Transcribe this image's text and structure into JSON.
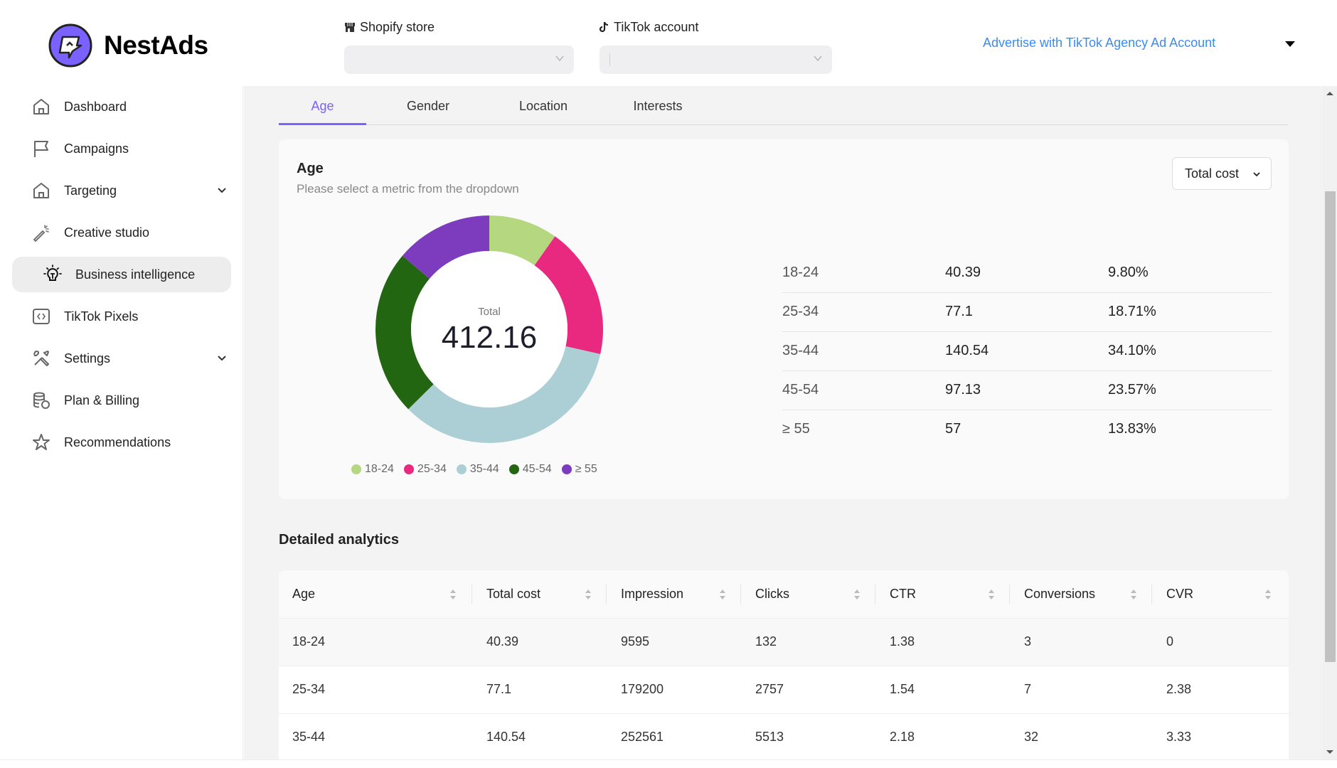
{
  "app": {
    "name": "NestAds",
    "brand_color": "#7b61ff"
  },
  "header": {
    "shopify_label": "Shopify store",
    "shopify_value": "",
    "tiktok_label": "TikTok account",
    "tiktok_value": "",
    "agency_link": "Advertise with TikTok Agency Ad Account"
  },
  "sidebar": {
    "items": [
      {
        "label": "Dashboard",
        "icon": "home-icon"
      },
      {
        "label": "Campaigns",
        "icon": "flag-icon"
      },
      {
        "label": "Targeting",
        "icon": "home-icon",
        "expandable": true
      },
      {
        "label": "Creative studio",
        "icon": "magic-wand-icon"
      },
      {
        "label": "Business intelligence",
        "icon": "lightbulb-icon",
        "active": true
      },
      {
        "label": "TikTok Pixels",
        "icon": "code-icon"
      },
      {
        "label": "Settings",
        "icon": "tools-icon",
        "expandable": true
      },
      {
        "label": "Plan & Billing",
        "icon": "database-icon"
      },
      {
        "label": "Recommendations",
        "icon": "star-icon"
      }
    ]
  },
  "tabs": [
    {
      "label": "Age",
      "active": true
    },
    {
      "label": "Gender"
    },
    {
      "label": "Location"
    },
    {
      "label": "Interests"
    }
  ],
  "card": {
    "title": "Age",
    "subtitle": "Please select a metric from the dropdown",
    "metric_selected": "Total cost",
    "center_label": "Total",
    "center_value": "412.16",
    "summary": [
      {
        "label": "18-24",
        "value": "40.39",
        "pct": "9.80%"
      },
      {
        "label": "25-34",
        "value": "77.1",
        "pct": "18.71%"
      },
      {
        "label": "35-44",
        "value": "140.54",
        "pct": "34.10%"
      },
      {
        "label": "45-54",
        "value": "97.13",
        "pct": "23.57%"
      },
      {
        "label": "≥ 55",
        "value": "57",
        "pct": "13.83%"
      }
    ]
  },
  "chart_data": {
    "type": "pie",
    "title": "Age",
    "subtitle": "Please select a metric from the dropdown",
    "metric": "Total cost",
    "donut": true,
    "center_label": "Total",
    "total": 412.16,
    "categories": [
      "18-24",
      "25-34",
      "35-44",
      "45-54",
      "≥ 55"
    ],
    "values": [
      40.39,
      77.1,
      140.54,
      97.13,
      57
    ],
    "percentages": [
      9.8,
      18.71,
      34.1,
      23.57,
      13.83
    ],
    "colors": [
      "#b5d780",
      "#e9287f",
      "#accfd5",
      "#226611",
      "#7d3bbd"
    ],
    "legend": "bottom"
  },
  "detailed": {
    "title": "Detailed analytics",
    "columns": [
      "Age",
      "Total cost",
      "Impression",
      "Clicks",
      "CTR",
      "Conversions",
      "CVR"
    ],
    "rows": [
      [
        "18-24",
        "40.39",
        "9595",
        "132",
        "1.38",
        "3",
        "0"
      ],
      [
        "25-34",
        "77.1",
        "179200",
        "2757",
        "1.54",
        "7",
        "2.38"
      ],
      [
        "35-44",
        "140.54",
        "252561",
        "5513",
        "2.18",
        "32",
        "3.33"
      ]
    ]
  }
}
